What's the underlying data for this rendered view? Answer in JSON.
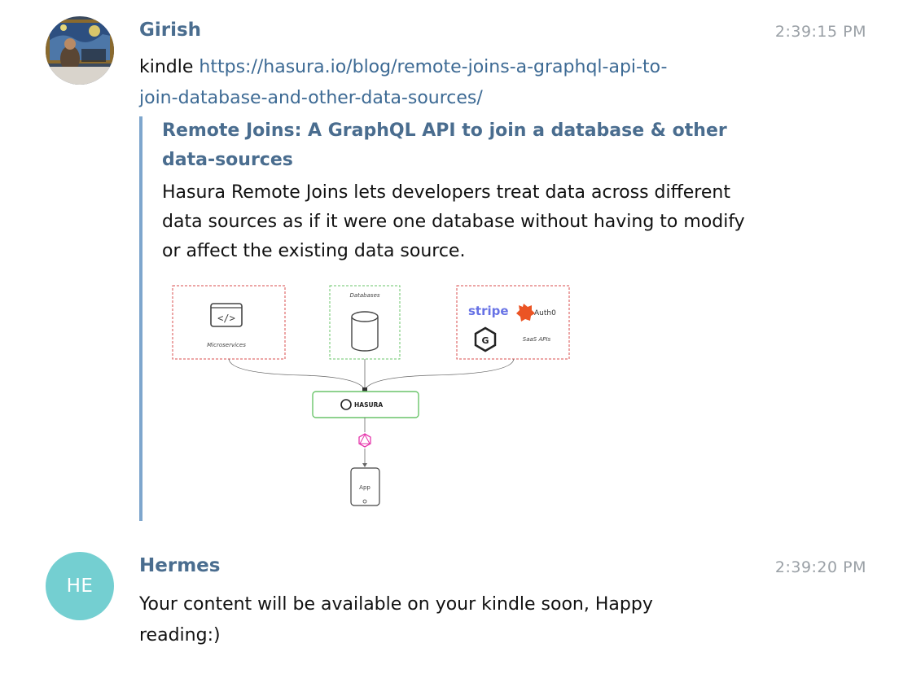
{
  "messages": [
    {
      "sender": "Girish",
      "time": "2:39:15 PM",
      "avatar": "photo",
      "text_prefix": "kindle ",
      "link": "https://hasura.io/blog/remote-joins-a-graphql-api-to-join-database-and-other-data-sources/",
      "link_line1": "https://hasura.io/blog/remote-joins-a-graphql-api-to-",
      "link_line2": "join-database-and-other-data-sources/",
      "preview": {
        "title": "Remote Joins: A GraphQL API to join a database & other data-sources",
        "description": "Hasura Remote Joins lets developers treat data across different data sources as if it were one database without having to modify or affect the existing data source.",
        "diagram": {
          "microservices_label": "Microservices",
          "databases_label": "Databases",
          "stripe_label": "stripe",
          "auth0_label": "Auth0",
          "saas_label": "SaaS APIs",
          "hasura_label": "HASURA",
          "app_label": "App",
          "code_symbol": "</>",
          "g_symbol": "G"
        }
      }
    },
    {
      "sender": "Hermes",
      "time": "2:39:20 PM",
      "avatar_initials": "HE",
      "text": "Your content will be available on your kindle soon, Happy reading:)"
    }
  ],
  "colors": {
    "sender": "#4a6d8f",
    "link": "#3d6a94",
    "preview_bar": "#7ea6cd",
    "avatar_he": "#74cfd1",
    "timestamp": "#9aa0a6"
  }
}
